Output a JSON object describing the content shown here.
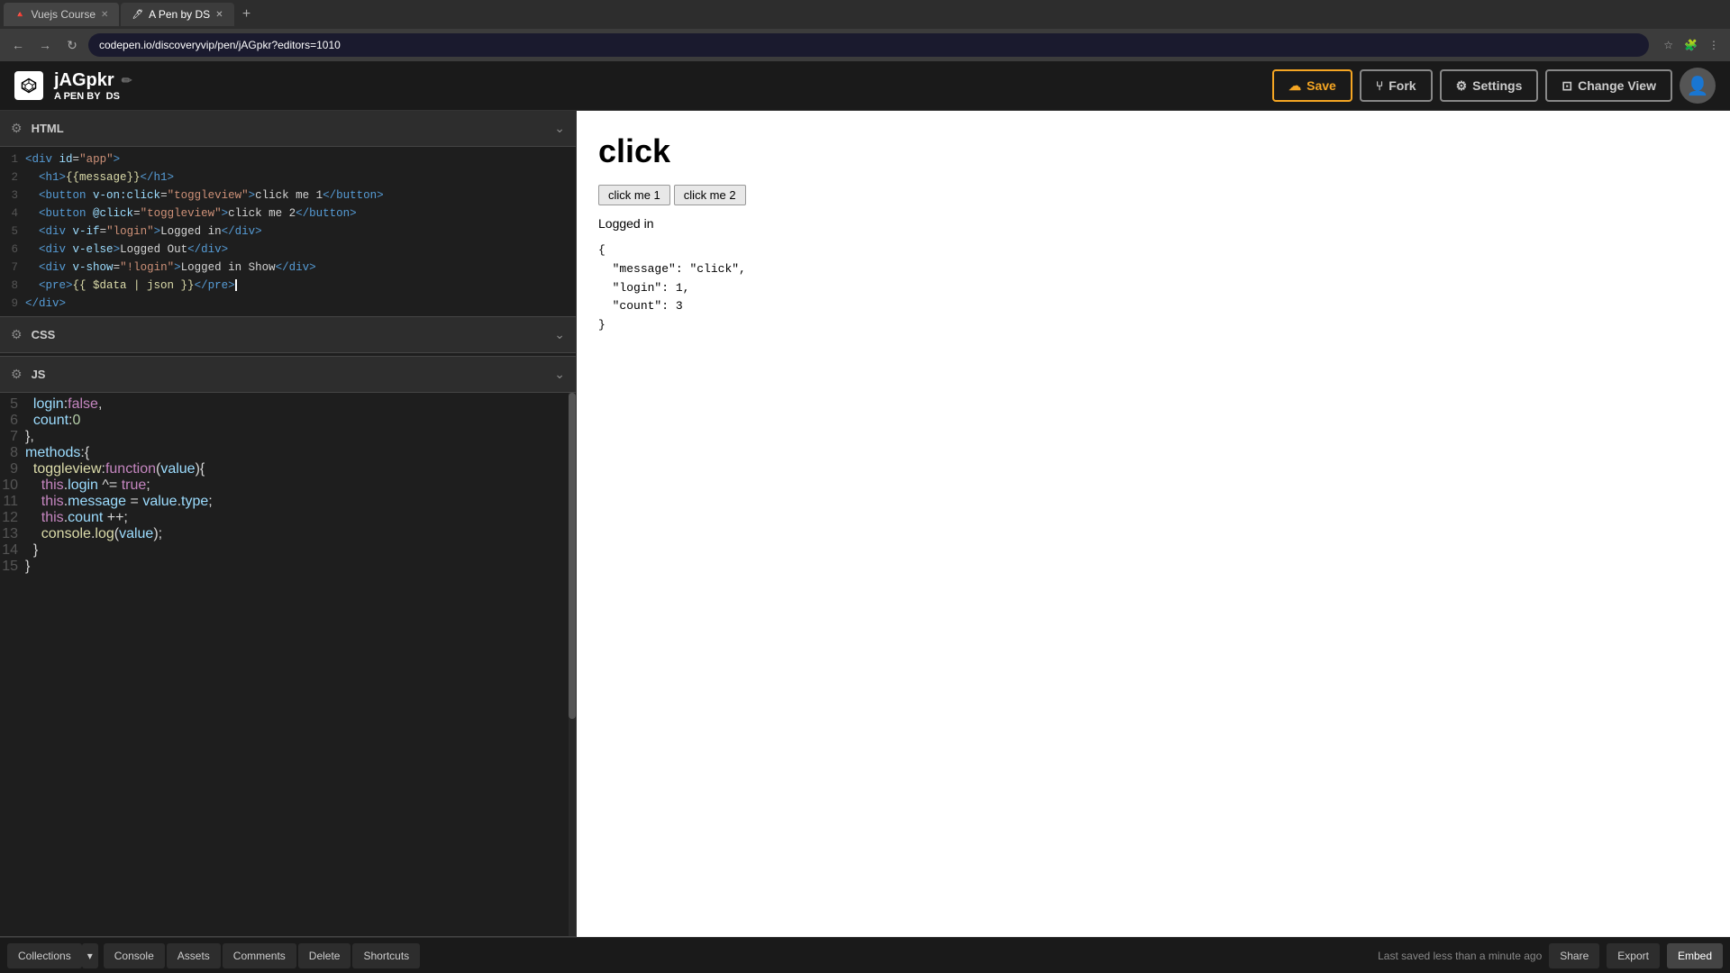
{
  "browser": {
    "tabs": [
      {
        "label": "Vuejs Course",
        "active": false,
        "favicon": "V"
      },
      {
        "label": "A Pen by DS",
        "active": true,
        "favicon": "P"
      }
    ],
    "new_tab_label": "+",
    "address": "codepen.io/discoveryvip/pen/jAGpkr?editors=1010",
    "nav": {
      "back": "←",
      "forward": "→",
      "refresh": "↻"
    }
  },
  "header": {
    "pen_id": "jAGpkr",
    "edit_icon": "✏",
    "pen_by_label": "A PEN BY",
    "pen_by_author": "DS",
    "save_label": "Save",
    "fork_label": "Fork",
    "settings_label": "Settings",
    "change_view_label": "Change View"
  },
  "panels": {
    "html": {
      "label": "HTML",
      "lines": [
        {
          "num": "1",
          "code": "<div id=\"app\">"
        },
        {
          "num": "2",
          "code": "  <h1>{{message}}</h1>"
        },
        {
          "num": "3",
          "code": "  <button v-on:click=\"toggleview\">click me 1</button>"
        },
        {
          "num": "4",
          "code": "  <button @click=\"toggleview\">click me 2</button>"
        },
        {
          "num": "5",
          "code": "  <div v-if=\"login\">Logged in</div>"
        },
        {
          "num": "6",
          "code": "  <div v-else>Logged Out</div>"
        },
        {
          "num": "7",
          "code": "  <div v-show=\"!login\">Logged in Show</div>"
        },
        {
          "num": "8",
          "code": "  <pre>{{ $data | json }}</pre>"
        },
        {
          "num": "9",
          "code": "</div>"
        }
      ]
    },
    "css": {
      "label": "CSS"
    },
    "js": {
      "label": "JS",
      "lines": [
        {
          "num": "5",
          "code": "  login:false,"
        },
        {
          "num": "6",
          "code": "  count:0"
        },
        {
          "num": "7",
          "code": "},"
        },
        {
          "num": "8",
          "code": "methods:{"
        },
        {
          "num": "9",
          "code": "  toggleview:function(value){"
        },
        {
          "num": "10",
          "code": "    this.login ^= true;"
        },
        {
          "num": "11",
          "code": "    this.message = value.type;"
        },
        {
          "num": "12",
          "code": "    this.count ++;"
        },
        {
          "num": "13",
          "code": "    console.log(value);"
        },
        {
          "num": "14",
          "code": "  }"
        },
        {
          "num": "15",
          "code": "}"
        }
      ]
    }
  },
  "preview": {
    "h1": "click",
    "btn1": "click me 1",
    "btn2": "click me 2",
    "logged_status": "Logged in",
    "json_display": "{\n  \"message\": \"click\",\n  \"login\": 1,\n  \"count\": 3\n}"
  },
  "bottom_bar": {
    "collections_label": "Collections",
    "dropdown_arrow": "▾",
    "console_label": "Console",
    "assets_label": "Assets",
    "comments_label": "Comments",
    "delete_label": "Delete",
    "shortcuts_label": "Shortcuts",
    "save_status": "Last saved less than a minute ago",
    "share_label": "Share",
    "export_label": "Export",
    "embed_label": "Embed"
  },
  "colors": {
    "accent_orange": "#f5a623",
    "bg_dark": "#1e1e1e",
    "bg_panel": "#2d2d2d",
    "text_light": "#d4d4d4",
    "tag_blue": "#569cd6",
    "attr_light": "#9cdcfe",
    "string_orange": "#ce9178",
    "keyword_purple": "#c586c0",
    "fn_yellow": "#dcdcaa",
    "num_green": "#b5cea8"
  }
}
